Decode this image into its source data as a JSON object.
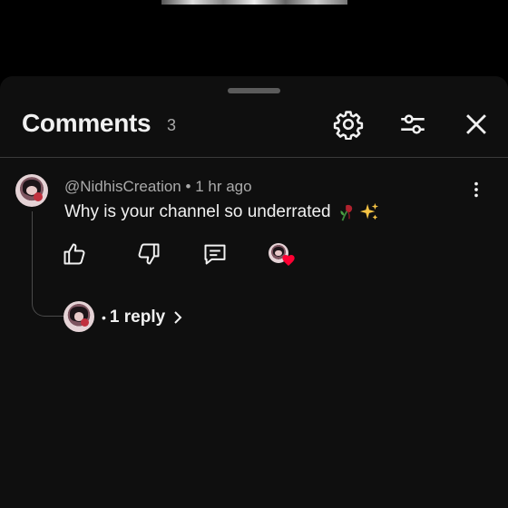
{
  "header": {
    "title": "Comments",
    "count": "3",
    "settings_icon": "gear-icon",
    "filter_icon": "sliders-icon",
    "close_icon": "close-icon"
  },
  "comment": {
    "author": "@NidhisCreation",
    "time": "1 hr ago",
    "meta_separator": "•",
    "text": "Why is your channel so underrated",
    "emojis": [
      "wilted-rose-emoji",
      "sparkles-emoji"
    ],
    "actions": [
      "thumbs-up-icon",
      "thumbs-down-icon",
      "reply-icon",
      "creator-heart-icon"
    ]
  },
  "replies": {
    "label": "1 reply",
    "bullet": "•"
  },
  "colors": {
    "sheet_bg": "#0f0f0f",
    "page_bg": "#000000",
    "text_primary": "#f1f1f1",
    "text_secondary": "#aaaaaa",
    "heart": "#ff0033"
  }
}
